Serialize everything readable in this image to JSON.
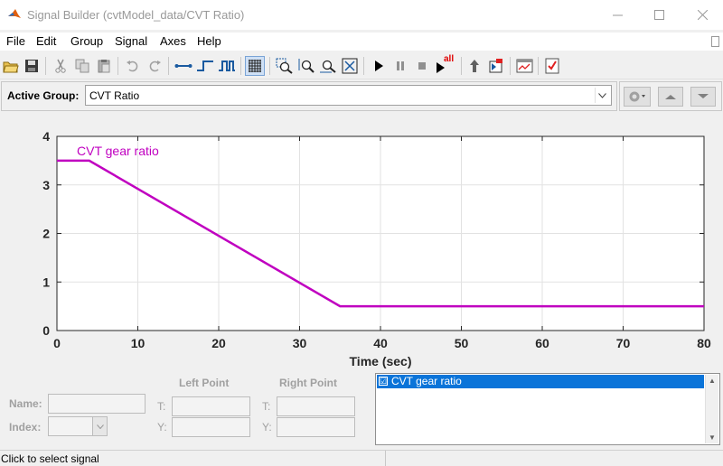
{
  "window": {
    "title": "Signal Builder (cvtModel_data/CVT Ratio)"
  },
  "menu": [
    "File",
    "Edit",
    "Group",
    "Signal",
    "Axes",
    "Help"
  ],
  "toolbar": {
    "tools": [
      "open-icon",
      "save-icon",
      "cut-icon",
      "copy-icon",
      "paste-icon",
      "undo-icon",
      "redo-icon",
      "add-segment-icon",
      "add-step-icon",
      "add-pulse-icon",
      "grid-icon",
      "zoom-xy-icon",
      "zoom-x-icon",
      "zoom-y-icon",
      "fit-icon",
      "play-icon",
      "pause-icon",
      "stop-icon",
      "play-all-icon",
      "up-icon",
      "show-signal-icon",
      "open-block-icon",
      "verification-icon"
    ],
    "play_all_label": "all",
    "grid_pressed": true
  },
  "group": {
    "label": "Active Group:",
    "value": "CVT Ratio"
  },
  "chart_data": {
    "type": "line",
    "series": [
      {
        "name": "CVT gear ratio",
        "color": "#c000c0",
        "x": [
          0,
          4,
          35,
          80
        ],
        "y": [
          3.5,
          3.5,
          0.5,
          0.5
        ]
      }
    ],
    "xlabel": "Time (sec)",
    "ylabel": "",
    "xlim": [
      0,
      80
    ],
    "ylim": [
      0,
      4
    ],
    "xticks": [
      0,
      10,
      20,
      30,
      40,
      50,
      60,
      70,
      80
    ],
    "yticks": [
      0,
      1,
      2,
      3,
      4
    ],
    "grid": true
  },
  "point_editor": {
    "name_label": "Name:",
    "index_label": "Index:",
    "left_point": "Left Point",
    "right_point": "Right Point",
    "t_label": "T:",
    "y_label": "Y:"
  },
  "signals": [
    {
      "label": "CVT gear ratio",
      "checked": "☑"
    }
  ],
  "status": "Click to select signal"
}
